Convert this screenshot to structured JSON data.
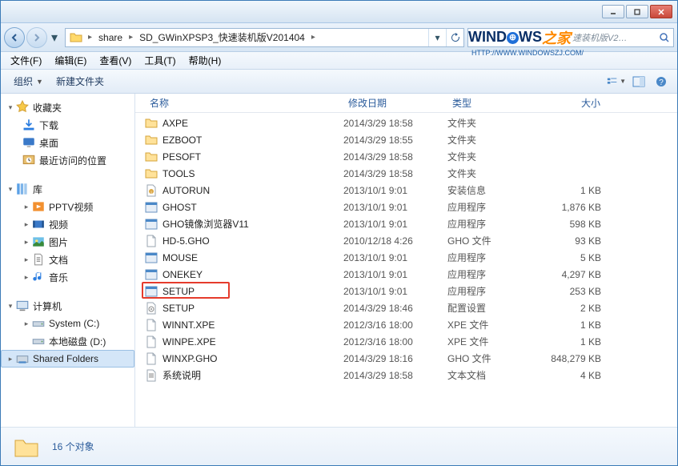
{
  "window_controls": {
    "min": "minimize",
    "max": "maximize",
    "close": "close"
  },
  "breadcrumb": {
    "segments": [
      "share",
      "SD_GWinXPSP3_快速装机版V201404"
    ]
  },
  "search": {
    "logo_parts": {
      "p1": "WIND",
      "p2": "WS",
      "p3_cn": "之家",
      "suffix": "速装机版V2…"
    },
    "logo_url": "HTTP://WWW.WINDOWSZJ.COM/"
  },
  "menubar": [
    "文件(F)",
    "编辑(E)",
    "查看(V)",
    "工具(T)",
    "帮助(H)"
  ],
  "toolbar": {
    "organize": "组织",
    "new_folder": "新建文件夹"
  },
  "sidebar": {
    "favorites": {
      "label": "收藏夹",
      "items": [
        "下载",
        "桌面",
        "最近访问的位置"
      ]
    },
    "libraries": {
      "label": "库",
      "items": [
        "PPTV视频",
        "视频",
        "图片",
        "文档",
        "音乐"
      ]
    },
    "computer": {
      "label": "计算机",
      "items": [
        "System (C:)",
        "本地磁盘 (D:)",
        "Shared Folders"
      ]
    }
  },
  "columns": {
    "name": "名称",
    "date": "修改日期",
    "type": "类型",
    "size": "大小"
  },
  "files": [
    {
      "icon": "folder",
      "name": "AXPE",
      "date": "2014/3/29 18:58",
      "type": "文件夹",
      "size": ""
    },
    {
      "icon": "folder",
      "name": "EZBOOT",
      "date": "2014/3/29 18:55",
      "type": "文件夹",
      "size": ""
    },
    {
      "icon": "folder",
      "name": "PESOFT",
      "date": "2014/3/29 18:58",
      "type": "文件夹",
      "size": ""
    },
    {
      "icon": "folder",
      "name": "TOOLS",
      "date": "2014/3/29 18:58",
      "type": "文件夹",
      "size": ""
    },
    {
      "icon": "inf",
      "name": "AUTORUN",
      "date": "2013/10/1 9:01",
      "type": "安装信息",
      "size": "1 KB"
    },
    {
      "icon": "exe",
      "name": "GHOST",
      "date": "2013/10/1 9:01",
      "type": "应用程序",
      "size": "1,876 KB"
    },
    {
      "icon": "exe",
      "name": "GHO镜像浏览器V11",
      "date": "2013/10/1 9:01",
      "type": "应用程序",
      "size": "598 KB"
    },
    {
      "icon": "file",
      "name": "HD-5.GHO",
      "date": "2010/12/18 4:26",
      "type": "GHO 文件",
      "size": "93 KB"
    },
    {
      "icon": "exe",
      "name": "MOUSE",
      "date": "2013/10/1 9:01",
      "type": "应用程序",
      "size": "5 KB"
    },
    {
      "icon": "exe",
      "name": "ONEKEY",
      "date": "2013/10/1 9:01",
      "type": "应用程序",
      "size": "4,297 KB"
    },
    {
      "icon": "exe",
      "name": "SETUP",
      "date": "2013/10/1 9:01",
      "type": "应用程序",
      "size": "253 KB",
      "highlight": true
    },
    {
      "icon": "cfg",
      "name": "SETUP",
      "date": "2014/3/29 18:46",
      "type": "配置设置",
      "size": "2 KB"
    },
    {
      "icon": "file",
      "name": "WINNT.XPE",
      "date": "2012/3/16 18:00",
      "type": "XPE 文件",
      "size": "1 KB"
    },
    {
      "icon": "file",
      "name": "WINPE.XPE",
      "date": "2012/3/16 18:00",
      "type": "XPE 文件",
      "size": "1 KB"
    },
    {
      "icon": "file",
      "name": "WINXP.GHO",
      "date": "2014/3/29 18:16",
      "type": "GHO 文件",
      "size": "848,279 KB"
    },
    {
      "icon": "txt",
      "name": "系统说明",
      "date": "2014/3/29 18:58",
      "type": "文本文档",
      "size": "4 KB"
    }
  ],
  "status": {
    "count_label": "16 个对象"
  }
}
